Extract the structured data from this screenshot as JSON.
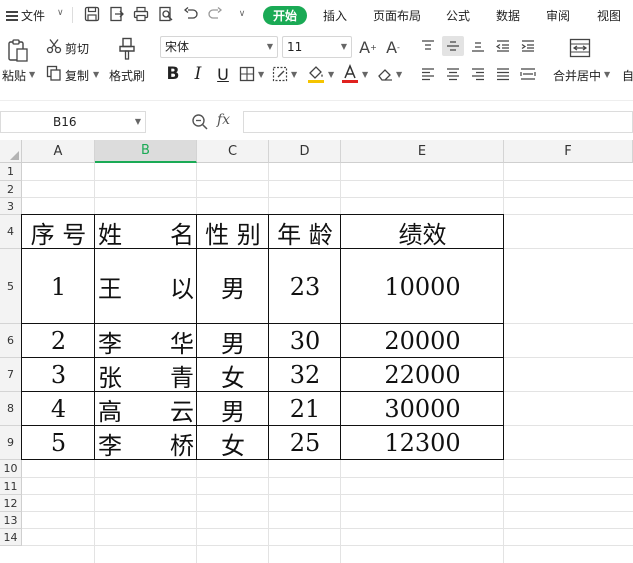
{
  "menubar": {
    "file": "文件",
    "tabs": [
      "开始",
      "插入",
      "页面布局",
      "公式",
      "数据",
      "审阅",
      "视图"
    ],
    "active_tab": "开始",
    "accent": "#1aaa55"
  },
  "ribbon": {
    "paste": "粘贴",
    "cut": "剪切",
    "copy": "复制",
    "format_painter": "格式刷",
    "font_name": "宋体",
    "font_size": "11",
    "merge_center": "合并居中",
    "auto_wrap_partial": "自"
  },
  "formula_bar": {
    "cell_ref": "B16",
    "fx": "fx",
    "formula": ""
  },
  "sheet": {
    "columns": [
      "A",
      "B",
      "C",
      "D",
      "E",
      "F"
    ],
    "selected_column": "B",
    "rows": [
      "1",
      "2",
      "3",
      "4",
      "5",
      "6",
      "7",
      "8",
      "9",
      "10",
      "11",
      "12",
      "13",
      "14"
    ],
    "table": {
      "headers": [
        "序 号",
        "姓　　名",
        "性 别",
        "年 龄",
        "绩效"
      ],
      "records": [
        [
          "1",
          "王　　以",
          "男",
          "23",
          "10000"
        ],
        [
          "2",
          "李　　华",
          "男",
          "30",
          "20000"
        ],
        [
          "3",
          "张　　青",
          "女",
          "32",
          "22000"
        ],
        [
          "4",
          "高　　云",
          "男",
          "21",
          "30000"
        ],
        [
          "5",
          "李　　桥",
          "女",
          "25",
          "12300"
        ]
      ]
    }
  }
}
